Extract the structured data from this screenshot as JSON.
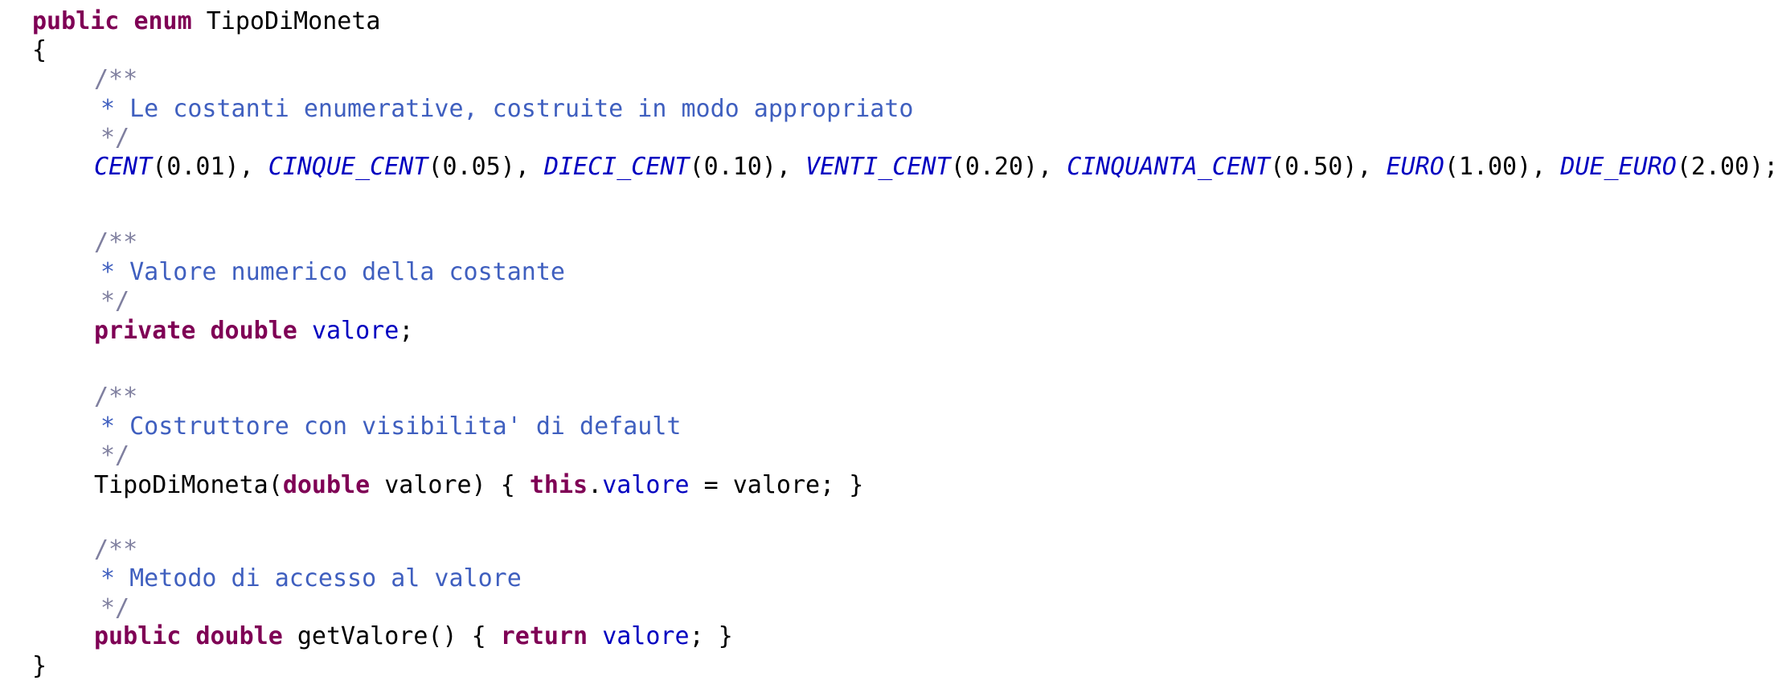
{
  "code": {
    "decl_public": "public",
    "decl_enum": "enum",
    "enum_name": "TipoDiMoneta",
    "open_brace": "{",
    "close_brace": "}",
    "doc1": {
      "open": "/**",
      "text": "* Le costanti enumerative, costruite in modo appropriato",
      "close": "*/"
    },
    "constants": [
      {
        "name": "CENT",
        "arg": "(0.01)",
        "sep": ", "
      },
      {
        "name": "CINQUE_CENT",
        "arg": "(0.05)",
        "sep": ", "
      },
      {
        "name": "DIECI_CENT",
        "arg": "(0.10)",
        "sep": ", "
      },
      {
        "name": "VENTI_CENT",
        "arg": "(0.20)",
        "sep": ", "
      },
      {
        "name": "CINQUANTA_CENT",
        "arg": "(0.50)",
        "sep": ", "
      },
      {
        "name": "EURO",
        "arg": "(1.00)",
        "sep": ", "
      },
      {
        "name": "DUE_EURO",
        "arg": "(2.00)",
        "sep": ";"
      }
    ],
    "doc2": {
      "open": "/**",
      "text": "* Valore numerico della costante",
      "close": "*/"
    },
    "field_line": {
      "private": "private",
      "double": "double",
      "name": "valore",
      "end": ";"
    },
    "doc3": {
      "open": "/**",
      "text": "* Costruttore con visibilita' di default",
      "close": "*/"
    },
    "ctor_line": {
      "name": "TipoDiMoneta(",
      "double": "double",
      "param": " valore) { ",
      "this": "this",
      "dot": ".",
      "field": "valore",
      "rest": " = valore; }"
    },
    "doc4": {
      "open": "/**",
      "text": "* Metodo di accesso al valore",
      "close": "*/"
    },
    "getter_line": {
      "public": "public",
      "double": "double",
      "name": " getValore() { ",
      "return": "return",
      "field": "valore",
      "end": "; }"
    }
  },
  "colors": {
    "keyword": "#7f0055",
    "javadoc": "#3f5fbf",
    "enum_constant": "#0000c0",
    "field": "#0000c0",
    "text": "#000000",
    "background": "#ffffff"
  }
}
